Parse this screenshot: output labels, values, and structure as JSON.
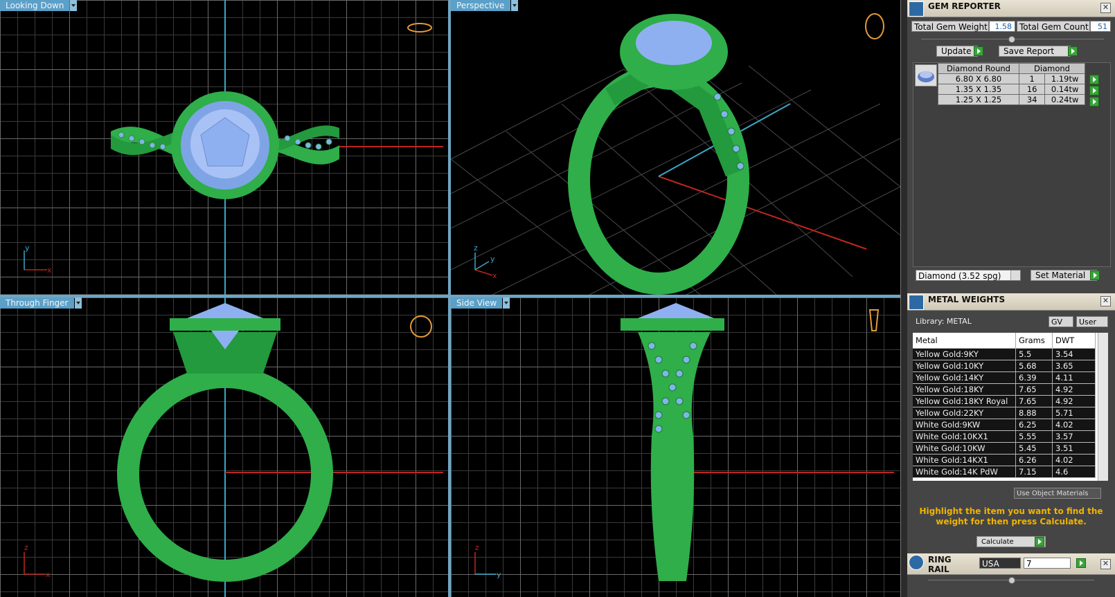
{
  "viewports": [
    {
      "label": "Looking Down",
      "axes": [
        "y",
        "x"
      ]
    },
    {
      "label": "Perspective",
      "axes": [
        "z",
        "y",
        "x"
      ]
    },
    {
      "label": "Through Finger",
      "axes": [
        "z",
        "x"
      ]
    },
    {
      "label": "Side View",
      "axes": [
        "z",
        "y"
      ]
    }
  ],
  "gem_reporter": {
    "title": "GEM REPORTER",
    "total_weight_label": "Total Gem Weight",
    "total_weight_value": "1.58",
    "total_count_label": "Total Gem Count",
    "total_count_value": "51",
    "update_label": "Update",
    "save_label": "Save Report",
    "table_header": [
      "Diamond Round",
      "Diamond"
    ],
    "rows": [
      {
        "size": "6.80 X 6.80",
        "count": "1",
        "tw": "1.19tw"
      },
      {
        "size": "1.35 X 1.35",
        "count": "16",
        "tw": "0.14tw"
      },
      {
        "size": "1.25 X 1.25",
        "count": "34",
        "tw": "0.24tw"
      }
    ],
    "material_select": "Diamond   (3.52 spg)",
    "set_material_label": "Set Material"
  },
  "metal_weights": {
    "title": "METAL WEIGHTS",
    "library": "Library: METAL",
    "gv": "GV",
    "user": "User",
    "headers": [
      "Metal",
      "Grams",
      "DWT"
    ],
    "rows": [
      [
        "Yellow Gold:9KY",
        "5.5",
        "3.54"
      ],
      [
        "Yellow Gold:10KY",
        "5.68",
        "3.65"
      ],
      [
        "Yellow Gold:14KY",
        "6.39",
        "4.11"
      ],
      [
        "Yellow Gold:18KY",
        "7.65",
        "4.92"
      ],
      [
        "Yellow Gold:18KY Royal",
        "7.65",
        "4.92"
      ],
      [
        "Yellow Gold:22KY",
        "8.88",
        "5.71"
      ],
      [
        "White Gold:9KW",
        "6.25",
        "4.02"
      ],
      [
        "White Gold:10KX1",
        "5.55",
        "3.57"
      ],
      [
        "White Gold:10KW",
        "5.45",
        "3.51"
      ],
      [
        "White Gold:14KX1",
        "6.26",
        "4.02"
      ],
      [
        "White Gold:14K PdW",
        "7.15",
        "4.6"
      ]
    ],
    "use_object_materials": "Use Object Materials",
    "message": "Highlight the item you want to find the weight for then press Calculate.",
    "calculate_label": "Calculate"
  },
  "ring_rail": {
    "title": "RING RAIL",
    "region": "USA",
    "size": "7"
  },
  "colors": {
    "metal": "#2fae4a",
    "gem": "#8fb0f0",
    "label": "#5aa0c8",
    "accent_text": "#f0b400"
  }
}
